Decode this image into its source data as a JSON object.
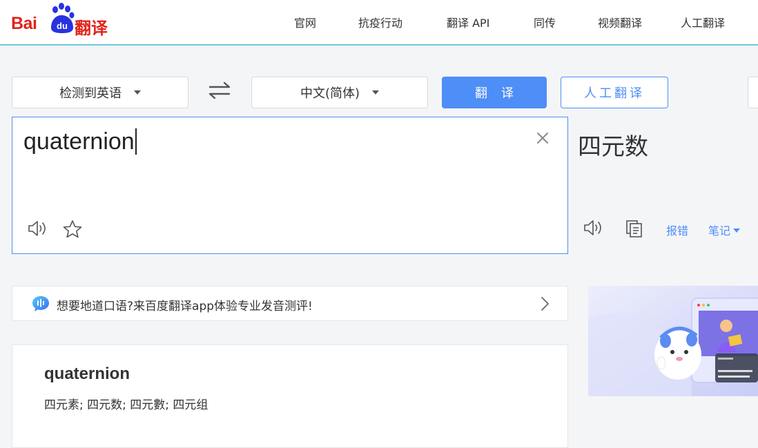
{
  "brand": {
    "logo_latin": "Bai",
    "logo_du": "du",
    "logo_cn": "翻译"
  },
  "nav": {
    "items": [
      "官网",
      "抗疫行动",
      "翻译 API",
      "同传",
      "视频翻译",
      "人工翻译"
    ]
  },
  "toolbar": {
    "source_lang": "检测到英语",
    "target_lang": "中文(简体)",
    "translate_label": "翻译",
    "human_label": "人工翻译"
  },
  "input": {
    "text": "quaternion"
  },
  "output": {
    "text": "四元数",
    "report_label": "报错",
    "note_label": "笔记"
  },
  "promo": {
    "text": "想要地道口语?来百度翻译app体验专业发音测评!"
  },
  "dict": {
    "word": "quaternion",
    "meaning": "四元素; 四元数; 四元數; 四元组"
  },
  "colors": {
    "brand_red": "#e2231a",
    "accent_blue": "#4e8ef7"
  }
}
